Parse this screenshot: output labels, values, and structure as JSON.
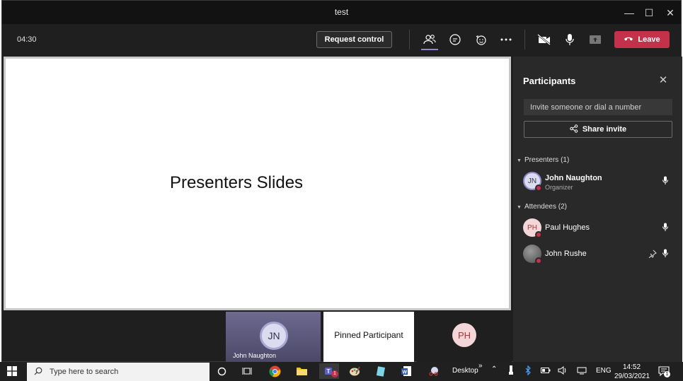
{
  "window": {
    "title": "test"
  },
  "meeting": {
    "timer": "04:30",
    "request_control": "Request control",
    "leave": "Leave"
  },
  "stage": {
    "slide_text": "Presenters Slides"
  },
  "tiles": [
    {
      "initials": "JN",
      "name": "John Naughton"
    },
    {
      "label": "Pinned Participant"
    },
    {
      "initials": "PH"
    }
  ],
  "panel": {
    "title": "Participants",
    "invite_placeholder": "Invite someone or dial a number",
    "share_invite": "Share invite",
    "presenters_header": "Presenters (1)",
    "attendees_header": "Attendees (2)",
    "presenters": [
      {
        "initials": "JN",
        "name": "John Naughton",
        "role": "Organizer"
      }
    ],
    "attendees": [
      {
        "initials": "PH",
        "name": "Paul Hughes"
      },
      {
        "name": "John Rushe"
      }
    ]
  },
  "taskbar": {
    "search_placeholder": "Type here to search",
    "desktop_label": "Desktop",
    "language": "ENG",
    "time": "14:52",
    "date": "29/03/2021",
    "teams_badge": "1",
    "notification_badge": "1"
  },
  "colors": {
    "leave": "#c4314b",
    "accent": "#8b8cc7",
    "ph_avatar": "#f4d6d8"
  }
}
